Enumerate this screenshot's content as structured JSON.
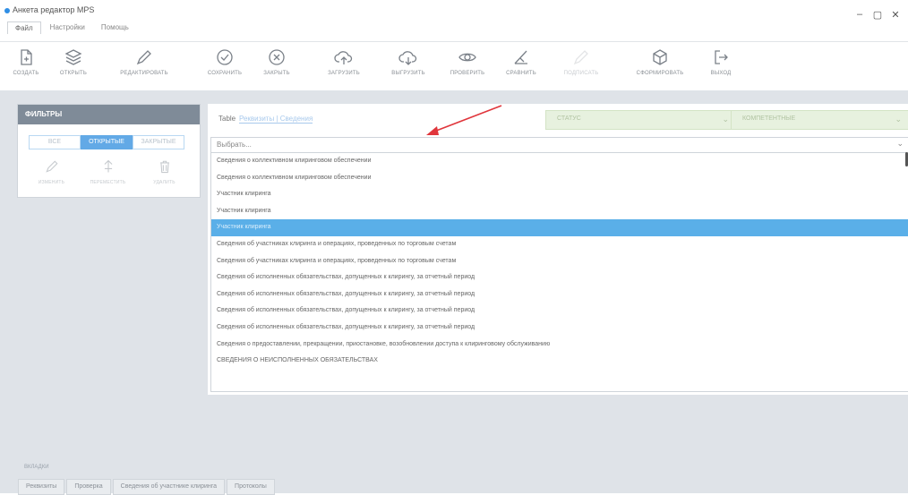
{
  "window": {
    "title": "Анкета редактор MPS",
    "minimize": "–",
    "maximize": "▢",
    "close": "✕"
  },
  "menu": [
    {
      "label": "Файл",
      "active": true
    },
    {
      "label": "Настройки",
      "active": false
    },
    {
      "label": "Помощь",
      "active": false
    }
  ],
  "toolbar": [
    {
      "label": "СОЗДАТЬ",
      "icon": "create-doc-icon",
      "enabled": true
    },
    {
      "label": "ОТКРЫТЬ",
      "icon": "layers-icon",
      "enabled": true
    },
    {
      "label": "РЕДАКТИРОВАТЬ",
      "icon": "pencil-icon",
      "enabled": true
    },
    {
      "label": "СОХРАНИТЬ",
      "icon": "check-circle-icon",
      "enabled": true
    },
    {
      "label": "ЗАКРЫТЬ",
      "icon": "close-circle-icon",
      "enabled": true
    },
    {
      "label": "ЗАГРУЗИТЬ",
      "icon": "cloud-upload-icon",
      "enabled": true
    },
    {
      "label": "ВЫГРУЗИТЬ",
      "icon": "cloud-download-icon",
      "enabled": true
    },
    {
      "label": "ПРОВЕРИТЬ",
      "icon": "eye-icon",
      "enabled": true
    },
    {
      "label": "СРАВНИТЬ",
      "icon": "compare-icon",
      "enabled": true
    },
    {
      "label": "ПОДПИСАТЬ",
      "icon": "sign-icon",
      "enabled": false
    },
    {
      "label": "СФОРМИРОВАТЬ",
      "icon": "cube-icon",
      "enabled": true
    },
    {
      "label": "ВЫХОД",
      "icon": "exit-icon",
      "enabled": true
    }
  ],
  "filters": {
    "title": "ФИЛЬТРЫ",
    "segments": [
      {
        "label": "ВСЕ",
        "active": false
      },
      {
        "label": "ОТКРЫТЫЕ",
        "active": true
      },
      {
        "label": "ЗАКРЫТЫЕ",
        "active": false
      }
    ],
    "tools": [
      {
        "label": "ИЗМЕНИТЬ",
        "icon": "pencil-icon"
      },
      {
        "label": "ПЕРЕМЕСТИТЬ",
        "icon": "move-icon"
      },
      {
        "label": "УДАЛИТЬ",
        "icon": "trash-icon"
      }
    ]
  },
  "table": {
    "label": "Table",
    "link": "Реквизиты | Сведения",
    "status_placeholder": "СТАТУС",
    "category_placeholder": "КОМПЕТЕНТНЫЕ",
    "combo_placeholder": "Выбрать..."
  },
  "options": [
    "Сведения о коллективном клиринговом обеспечении",
    "Сведения о коллективном клиринговом обеспечении",
    "Участник клиринга",
    "Участник клиринга",
    "Участник клиринга",
    "Сведения об участниках клиринга и операциях, проведенных по торговым счетам",
    "Сведения об участниках клиринга и операциях, проведенных по торговым счетам",
    "Сведения об исполненных обязательствах, допущенных к клирингу, за отчетный период",
    "Сведения об исполненных обязательствах, допущенных к клирингу, за отчетный период",
    "Сведения об исполненных обязательствах, допущенных к клирингу, за отчетный период",
    "Сведения об исполненных обязательствах, допущенных к клирингу, за отчетный период",
    "Сведения о предоставлении, прекращении, приостановке, возобновлении доступа к клиринговому обслуживанию",
    "СВЕДЕНИЯ О НЕИСПОЛНЕННЫХ ОБЯЗАТЕЛЬСТВАХ"
  ],
  "selected_index": 4,
  "bottom": {
    "label": "ВКЛАДКИ",
    "tabs": [
      "Реквизиты",
      "Проверка",
      "Сведения об участнике клиринга",
      "Протоколы"
    ]
  },
  "colors": {
    "accent": "#5aafe8",
    "panel_header": "#7f8b98",
    "workspace": "#dfe3e8",
    "arrow": "#e0363c"
  }
}
